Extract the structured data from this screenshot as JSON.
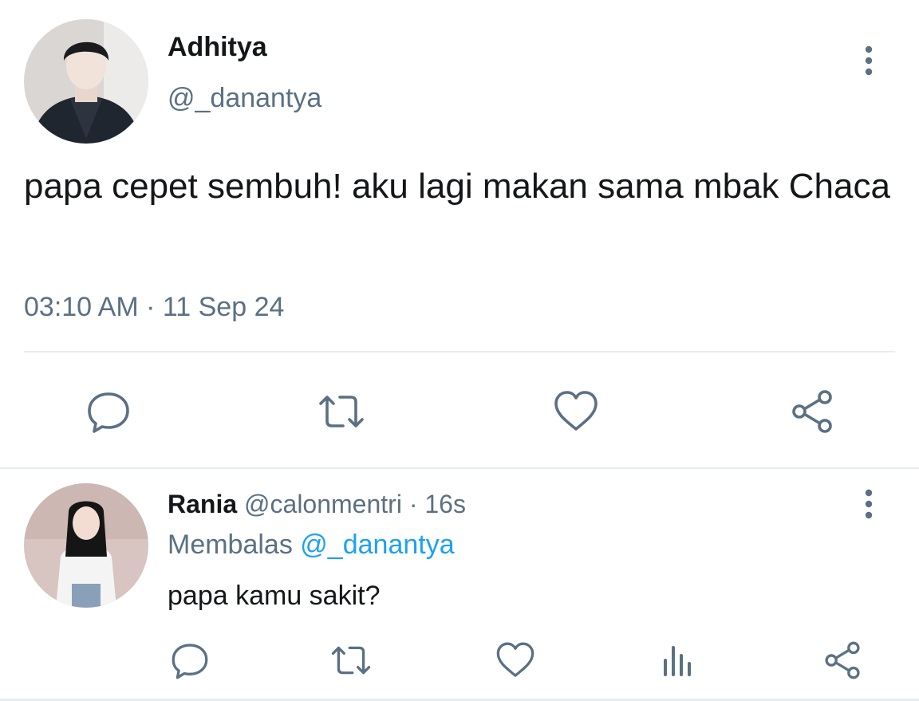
{
  "tweet": {
    "name": "Adhitya",
    "handle": "@_danantya",
    "text": "papa cepet sembuh! aku lagi makan sama mbak Chaca",
    "time": "03:10 AM",
    "separator": "·",
    "date": "11 Sep 24",
    "actions": [
      {
        "icon": "reply-icon"
      },
      {
        "icon": "retweet-icon"
      },
      {
        "icon": "like-icon"
      },
      {
        "icon": "share-icon"
      }
    ]
  },
  "reply": {
    "name": "Rania",
    "handle": "@calonmentri",
    "separator": "·",
    "age": "16s",
    "replying_prefix": "Membalas",
    "replying_to": "@_danantya",
    "text": "papa kamu sakit?",
    "actions": [
      {
        "icon": "reply-icon"
      },
      {
        "icon": "retweet-icon"
      },
      {
        "icon": "like-icon"
      },
      {
        "icon": "analytics-icon"
      },
      {
        "icon": "share-icon"
      }
    ]
  },
  "colors": {
    "text_primary": "#14171a",
    "text_secondary": "#5b7083",
    "link": "#1da1f2",
    "divider": "#e6ecf0"
  }
}
